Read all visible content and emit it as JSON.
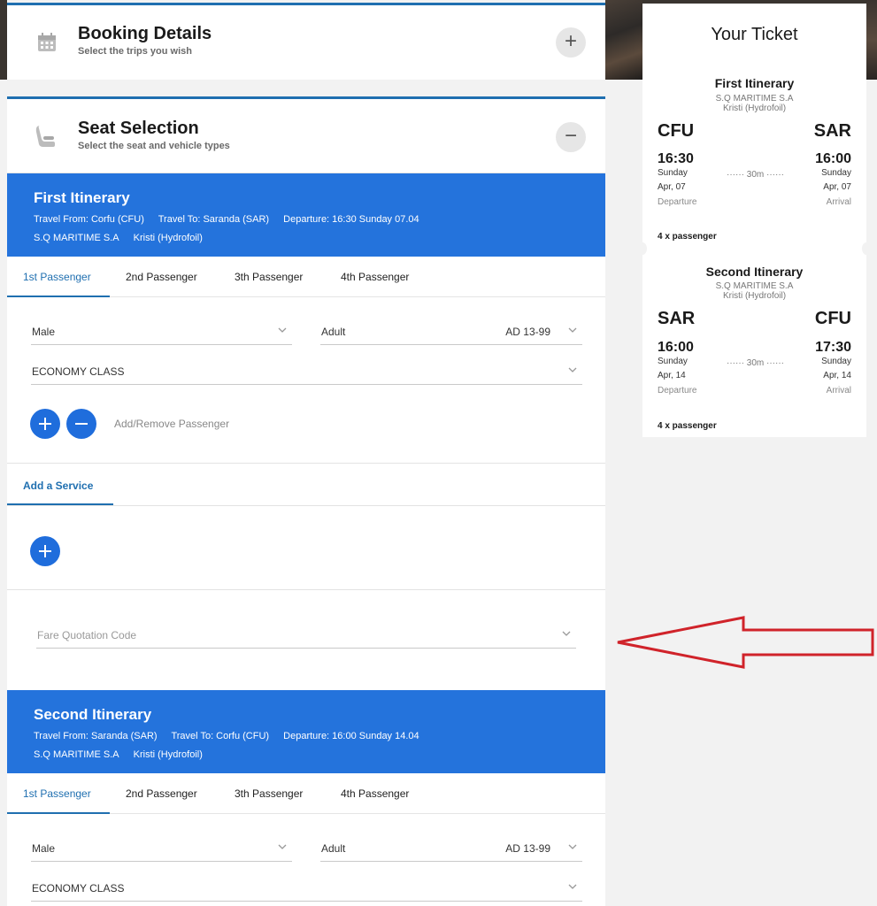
{
  "booking": {
    "title": "Booking Details",
    "subtitle": "Select the trips you wish",
    "toggle": "+"
  },
  "seat": {
    "title": "Seat Selection",
    "subtitle": "Select the seat and vehicle types",
    "toggle": "−"
  },
  "itineraries": [
    {
      "title": "First Itinerary",
      "from": "Travel From: Corfu (CFU)",
      "to": "Travel To: Saranda (SAR)",
      "departure": "Departure: 16:30 Sunday 07.04",
      "operator": "S.Q MARITIME S.A",
      "vessel": "Kristi (Hydrofoil)"
    },
    {
      "title": "Second Itinerary",
      "from": "Travel From: Saranda (SAR)",
      "to": "Travel To: Corfu (CFU)",
      "departure": "Departure: 16:00 Sunday 14.04",
      "operator": "S.Q MARITIME S.A",
      "vessel": "Kristi (Hydrofoil)"
    }
  ],
  "tabs": [
    "1st Passenger",
    "2nd Passenger",
    "3th Passenger",
    "4th Passenger"
  ],
  "passenger": {
    "gender": "Male",
    "age_type": "Adult",
    "age_range": "AD 13-99",
    "class": "ECONOMY CLASS",
    "add_remove": "Add/Remove Passenger"
  },
  "service": {
    "tab": "Add a Service"
  },
  "fare": {
    "placeholder": "Fare Quotation Code"
  },
  "ticket": {
    "title": "Your Ticket",
    "legs": [
      {
        "name": "First Itinerary",
        "operator": "S.Q MARITIME S.A",
        "vessel": "Kristi (Hydrofoil)",
        "from": "CFU",
        "to": "SAR",
        "dep_time": "16:30",
        "arr_time": "16:00",
        "dep_day": "Sunday",
        "arr_day": "Sunday",
        "dep_date": "Apr, 07",
        "arr_date": "Apr, 07",
        "duration": "30m",
        "dep_label": "Departure",
        "arr_label": "Arrival",
        "pax": "4 x passenger"
      },
      {
        "name": "Second Itinerary",
        "operator": "S.Q MARITIME S.A",
        "vessel": "Kristi (Hydrofoil)",
        "from": "SAR",
        "to": "CFU",
        "dep_time": "16:00",
        "arr_time": "17:30",
        "dep_day": "Sunday",
        "arr_day": "Sunday",
        "dep_date": "Apr, 14",
        "arr_date": "Apr, 14",
        "duration": "30m",
        "dep_label": "Departure",
        "arr_label": "Arrival",
        "pax": "4 x passenger"
      }
    ]
  },
  "colors": {
    "accent": "#2473dc",
    "annotation_arrow": "#d0232a"
  }
}
